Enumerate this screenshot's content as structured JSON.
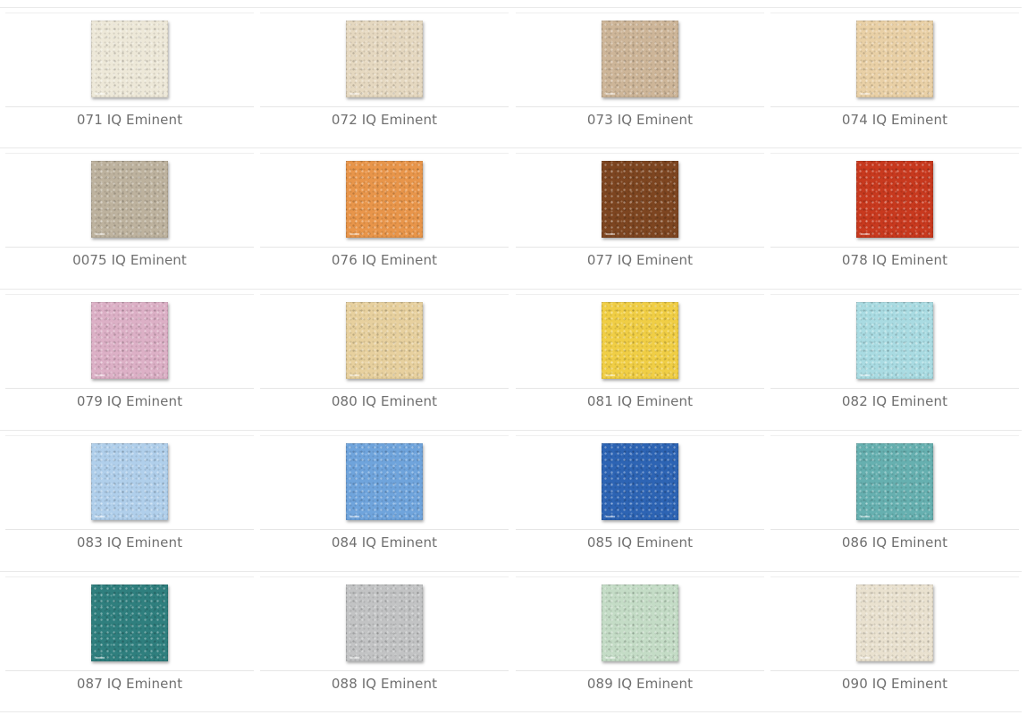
{
  "swatches": [
    {
      "label": "071 IQ Eminent",
      "color": "#ede8d8"
    },
    {
      "label": "072 IQ Eminent",
      "color": "#e5d8c0"
    },
    {
      "label": "073 IQ Eminent",
      "color": "#cdb598"
    },
    {
      "label": "074 IQ Eminent",
      "color": "#e9d0a6"
    },
    {
      "label": "0075 IQ Eminent",
      "color": "#bdb29e"
    },
    {
      "label": "076 IQ Eminent",
      "color": "#e8954a"
    },
    {
      "label": "077 IQ Eminent",
      "color": "#7d4520"
    },
    {
      "label": "078 IQ Eminent",
      "color": "#c8391e"
    },
    {
      "label": "079 IQ Eminent",
      "color": "#dcb0c6"
    },
    {
      "label": "080 IQ Eminent",
      "color": "#e7d09e"
    },
    {
      "label": "081 IQ Eminent",
      "color": "#f0ce45"
    },
    {
      "label": "082 IQ Eminent",
      "color": "#a9dbe2"
    },
    {
      "label": "083 IQ Eminent",
      "color": "#b0cfeb"
    },
    {
      "label": "084 IQ Eminent",
      "color": "#6fa4dc"
    },
    {
      "label": "085 IQ Eminent",
      "color": "#2d64b4"
    },
    {
      "label": "086 IQ Eminent",
      "color": "#66b0b0"
    },
    {
      "label": "087 IQ Eminent",
      "color": "#2f7f7e"
    },
    {
      "label": "088 IQ Eminent",
      "color": "#c2c3c4"
    },
    {
      "label": "089 IQ Eminent",
      "color": "#c4dcc6"
    },
    {
      "label": "090 IQ Eminent",
      "color": "#e9e1cf"
    }
  ]
}
